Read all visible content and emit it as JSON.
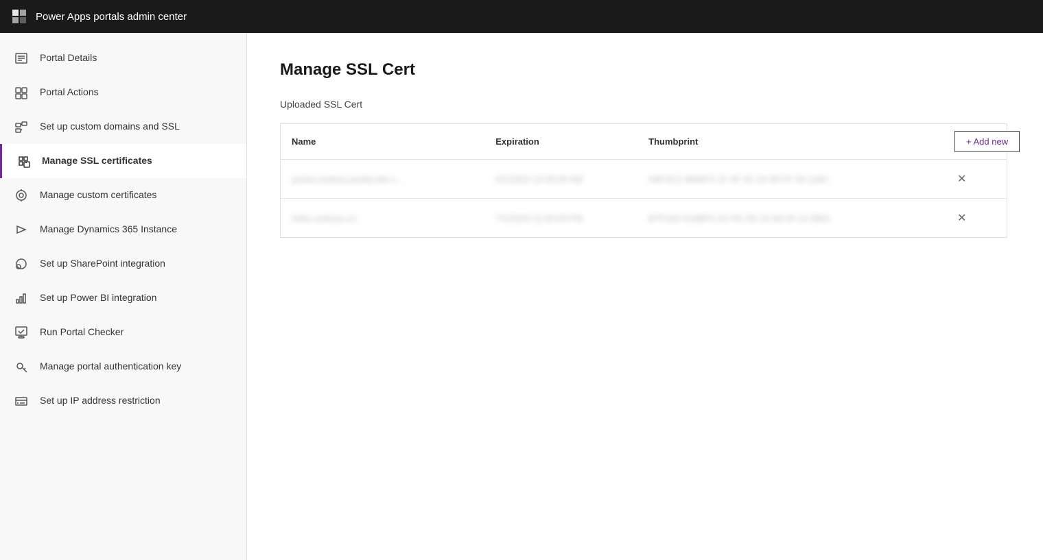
{
  "header": {
    "title": "Power Apps portals admin center"
  },
  "sidebar": {
    "items": [
      {
        "id": "portal-details",
        "label": "Portal Details",
        "icon": "list-icon",
        "active": false
      },
      {
        "id": "portal-actions",
        "label": "Portal Actions",
        "icon": "actions-icon",
        "active": false
      },
      {
        "id": "custom-domains",
        "label": "Set up custom domains and SSL",
        "icon": "domains-icon",
        "active": false
      },
      {
        "id": "manage-ssl",
        "label": "Manage SSL certificates",
        "icon": "ssl-icon",
        "active": true
      },
      {
        "id": "custom-certs",
        "label": "Manage custom certificates",
        "icon": "cert-icon",
        "active": false
      },
      {
        "id": "dynamics-instance",
        "label": "Manage Dynamics 365 Instance",
        "icon": "dynamics-icon",
        "active": false
      },
      {
        "id": "sharepoint",
        "label": "Set up SharePoint integration",
        "icon": "sharepoint-icon",
        "active": false
      },
      {
        "id": "power-bi",
        "label": "Set up Power BI integration",
        "icon": "powerbi-icon",
        "active": false
      },
      {
        "id": "portal-checker",
        "label": "Run Portal Checker",
        "icon": "checker-icon",
        "active": false
      },
      {
        "id": "auth-key",
        "label": "Manage portal authentication key",
        "icon": "auth-icon",
        "active": false
      },
      {
        "id": "ip-restriction",
        "label": "Set up IP address restriction",
        "icon": "ip-icon",
        "active": false
      }
    ]
  },
  "content": {
    "page_title": "Manage SSL Cert",
    "section_label": "Uploaded SSL Cert",
    "add_new_label": "+ Add new",
    "table": {
      "columns": [
        "Name",
        "Expiration",
        "Thumbprint"
      ],
      "rows": [
        {
          "name": "portal.contoso.portal.info.c...",
          "expiration": "6/1/2022 12:00:00 AM",
          "thumbprint": "A9F3C2 089AF3 1F 4F 4C 04 89 FF 03 1A91"
        },
        {
          "name": "hello.contoso.co",
          "expiration": "7/1/2023 11:59:59 PM",
          "thumbprint": "B7F2A4 019BF4 2G 5G 5D 15 9A 00 14 2B01"
        }
      ]
    }
  }
}
